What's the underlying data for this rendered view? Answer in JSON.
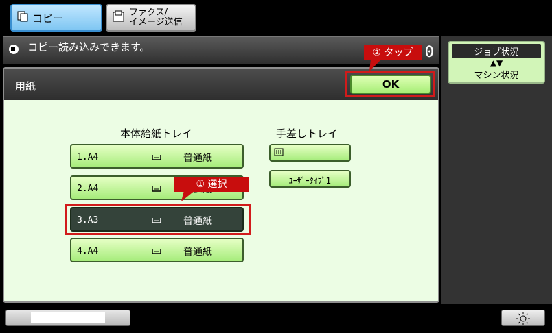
{
  "tabs": [
    {
      "label": "コピー"
    },
    {
      "label_line1": "ファクス/",
      "label_line2": "イメージ送信"
    }
  ],
  "status": {
    "message": "コピー読み込みできます。",
    "count": "0"
  },
  "side": {
    "job_status": "ジョブ状況",
    "machine_status": "マシン状況",
    "arrow": "▲▼"
  },
  "paper": {
    "title": "用紙",
    "ok_label": "OK",
    "main_tray_header": "本体給紙トレイ",
    "bypass_header": "手差しトレイ",
    "trays": [
      {
        "num": "1.A4",
        "type": "普通紙"
      },
      {
        "num": "2.A4",
        "type": "普通紙"
      },
      {
        "num": "3.A3",
        "type": "普通紙"
      },
      {
        "num": "4.A4",
        "type": "普通紙"
      }
    ],
    "bypass_type": "ﾕｰｻﾞｰﾀｲﾌﾟ1"
  },
  "callouts": {
    "tap": "② タップ",
    "select": "① 選択"
  },
  "colors": {
    "accent_red": "#c80d0d",
    "button_green": "#a6ec7b",
    "panel_bg": "#ecfde4"
  }
}
